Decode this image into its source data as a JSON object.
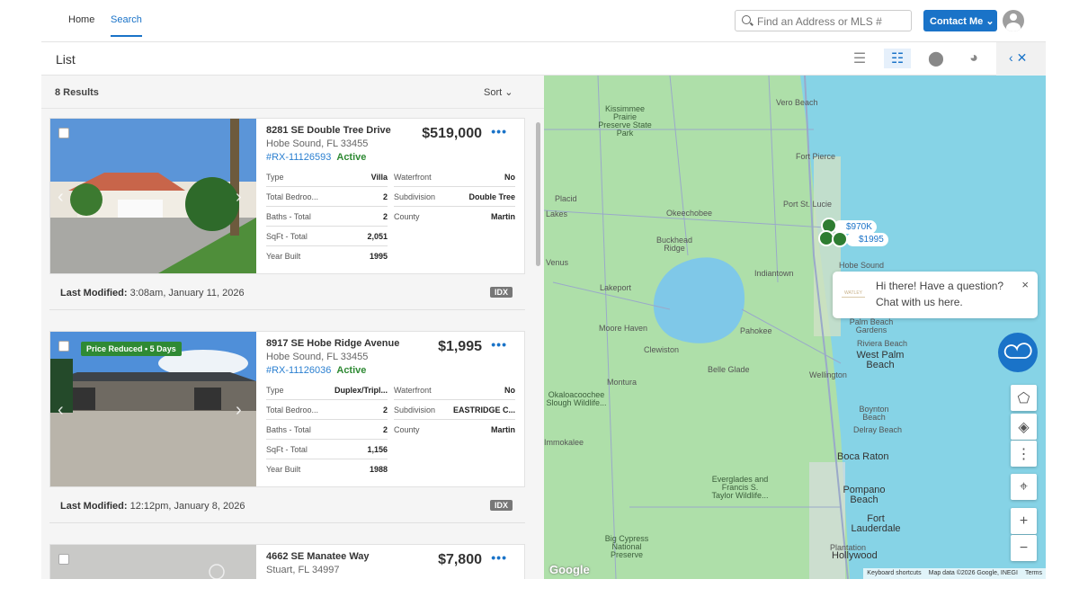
{
  "topbar": {
    "nav": [
      "Home",
      "Search"
    ],
    "search_placeholder": "Find an Address or MLS #",
    "contact_label": "Contact Me"
  },
  "subbar": {
    "title": "List",
    "views": [
      "list-compact",
      "list-detail",
      "map",
      "chart"
    ]
  },
  "list": {
    "results": "8 Results",
    "sort": "Sort"
  },
  "listings": [
    {
      "address": "8281 SE Double Tree Drive",
      "city": "Hobe Sound, FL 33455",
      "mls": "#RX-11126593",
      "status": "Active",
      "price": "$519,000",
      "badge": null,
      "left": [
        [
          "Type",
          "Villa"
        ],
        [
          "Total Bedroo...",
          "2"
        ],
        [
          "Baths - Total",
          "2"
        ],
        [
          "SqFt - Total",
          "2,051"
        ],
        [
          "Year Built",
          "1995"
        ]
      ],
      "right": [
        [
          "Waterfront",
          "No"
        ],
        [
          "Subdivision",
          "Double Tree"
        ],
        [
          "County",
          "Martin"
        ]
      ],
      "modified_label": "Last Modified:",
      "modified": "3:08am, January 11, 2026",
      "source": "IDX"
    },
    {
      "address": "8917 SE Hobe Ridge Avenue",
      "city": "Hobe Sound, FL 33455",
      "mls": "#RX-11126036",
      "status": "Active",
      "price": "$1,995",
      "badge": "Price Reduced • 5 Days",
      "left": [
        [
          "Type",
          "Duplex/Tripl..."
        ],
        [
          "Total Bedroo...",
          "2"
        ],
        [
          "Baths - Total",
          "2"
        ],
        [
          "SqFt - Total",
          "1,156"
        ],
        [
          "Year Built",
          "1988"
        ]
      ],
      "right": [
        [
          "Waterfront",
          "No"
        ],
        [
          "Subdivision",
          "EASTRIDGE C..."
        ],
        [
          "County",
          "Martin"
        ]
      ],
      "modified_label": "Last Modified:",
      "modified": "12:12pm, January 8, 2026",
      "source": "IDX"
    },
    {
      "address": "4662 SE Manatee Way",
      "city": "Stuart, FL 34997",
      "price": "$7,800"
    }
  ],
  "map": {
    "labels": [
      "Vero Beach",
      "Kissimmee Prairie Preserve State Park",
      "Fort Pierce",
      "Port St. Lucie",
      "Okeechobee",
      "Buckhead Ridge",
      "Indiantown",
      "Hobe Sound",
      "Lakeport",
      "Moore Haven",
      "Pahokee",
      "Clewiston",
      "Belle Glade",
      "West Palm Beach",
      "Riviera Beach",
      "Palm Beach Gardens",
      "Wellington",
      "Montura",
      "Okaloacoochee Slough Wildlife...",
      "Boynton Beach",
      "Delray Beach",
      "Boca Raton",
      "Everglades and Francis S. Taylor Wildlife...",
      "Pompano Beach",
      "Fort Lauderdale",
      "Big Cypress National Preserve",
      "Hollywood",
      "Venus",
      "Lakes",
      "Placid",
      "Plantation",
      "Immokalee"
    ],
    "markers": [
      "$970K",
      "$1995"
    ],
    "chat": {
      "line1": "Hi there! Have a question?",
      "line2": "Chat with us here.",
      "close": "×",
      "logo": "WATLEY"
    },
    "attribution": [
      "Keyboard shortcuts",
      "Map data ©2026 Google, INEGI",
      "Terms"
    ],
    "google": "Google"
  }
}
